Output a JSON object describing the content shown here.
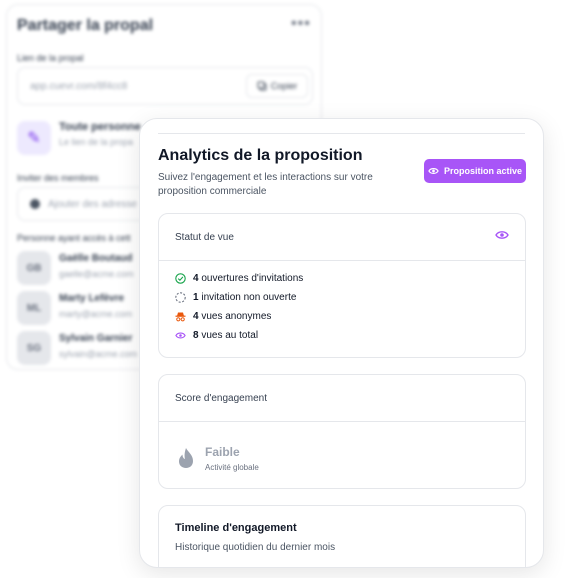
{
  "share": {
    "title": "Partager la propal",
    "more_icon": "more-horizontal-icon",
    "link_label": "Lien de la propal",
    "link_value": "app.cuevr.com/8f4cc8",
    "copy_label": "Copier",
    "everyone_title": "Toute personne",
    "everyone_sub": "Le lien de la propa",
    "invite_label": "Inviter des membres",
    "invite_placeholder": "Ajouter des adresse",
    "access_label": "Personne ayant accès à cett",
    "members": [
      {
        "initials": "GB",
        "name": "Gaëlle Boutaud",
        "email": "gaelle@acme.com"
      },
      {
        "initials": "ML",
        "name": "Marty Lefèvre",
        "email": "marty@acme.com"
      },
      {
        "initials": "SG",
        "name": "Sylvain Garnier",
        "email": "sylvain@acme.com"
      }
    ]
  },
  "analytics": {
    "title": "Analytics de la proposition",
    "subtitle": "Suivez l'engagement et les interactions sur votre proposition commerciale",
    "active_button": "Proposition active",
    "view_status": {
      "label": "Statut de vue",
      "rows": [
        {
          "count": "4",
          "text": "ouvertures d'invitations",
          "icon": "check-circle-icon",
          "color": "#16a34a"
        },
        {
          "count": "1",
          "text": "invitation non ouverte",
          "icon": "dashed-circle-icon",
          "color": "#6b7280"
        },
        {
          "count": "4",
          "text": "vues anonymes",
          "icon": "incognito-icon",
          "color": "#ea580c"
        },
        {
          "count": "8",
          "text": "vues au total",
          "icon": "eye-icon",
          "color": "#a855f7"
        }
      ]
    },
    "engagement": {
      "label": "Score d'engagement",
      "score": "Faible",
      "score_sub": "Activité globale"
    },
    "timeline": {
      "title": "Timeline d'engagement",
      "subtitle": "Historique quotidien du dernier mois"
    }
  },
  "colors": {
    "accent": "#a855f7",
    "success": "#16a34a",
    "warning": "#ea580c"
  }
}
